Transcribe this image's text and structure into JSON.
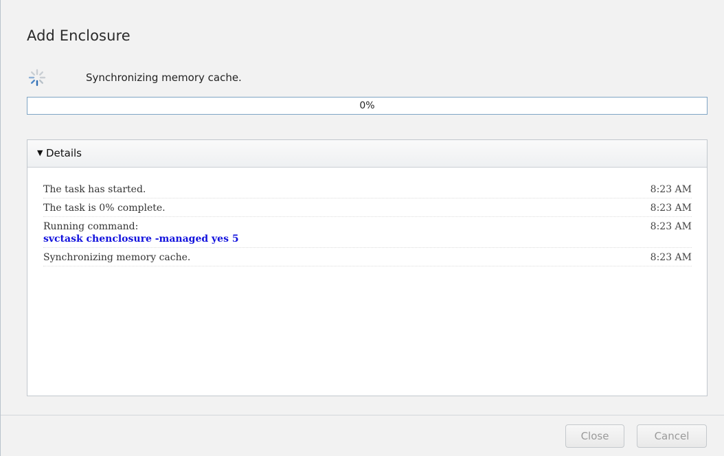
{
  "dialog": {
    "title": "Add Enclosure",
    "status_text": "Synchronizing memory cache.",
    "progress": {
      "percent": 0,
      "label": "0%"
    },
    "details": {
      "title": "Details",
      "expanded": true,
      "log": [
        {
          "text": "The task has started.",
          "time": "8:23 AM"
        },
        {
          "text": "The task is 0% complete.",
          "time": "8:23 AM"
        },
        {
          "text": "Running command:",
          "time": "8:23 AM",
          "command": "svctask chenclosure -managed yes 5"
        },
        {
          "text": "Synchronizing memory cache.",
          "time": "8:23 AM"
        }
      ]
    },
    "buttons": {
      "close_label": "Close",
      "cancel_label": "Cancel",
      "close_enabled": false,
      "cancel_enabled": false
    }
  },
  "icons": {
    "spinner": "spinner-icon",
    "details_toggle": "caret-down-icon"
  },
  "colors": {
    "command_text": "#1111dd",
    "progress_border": "#7ea4c4",
    "dialog_background": "#f2f2f2"
  }
}
